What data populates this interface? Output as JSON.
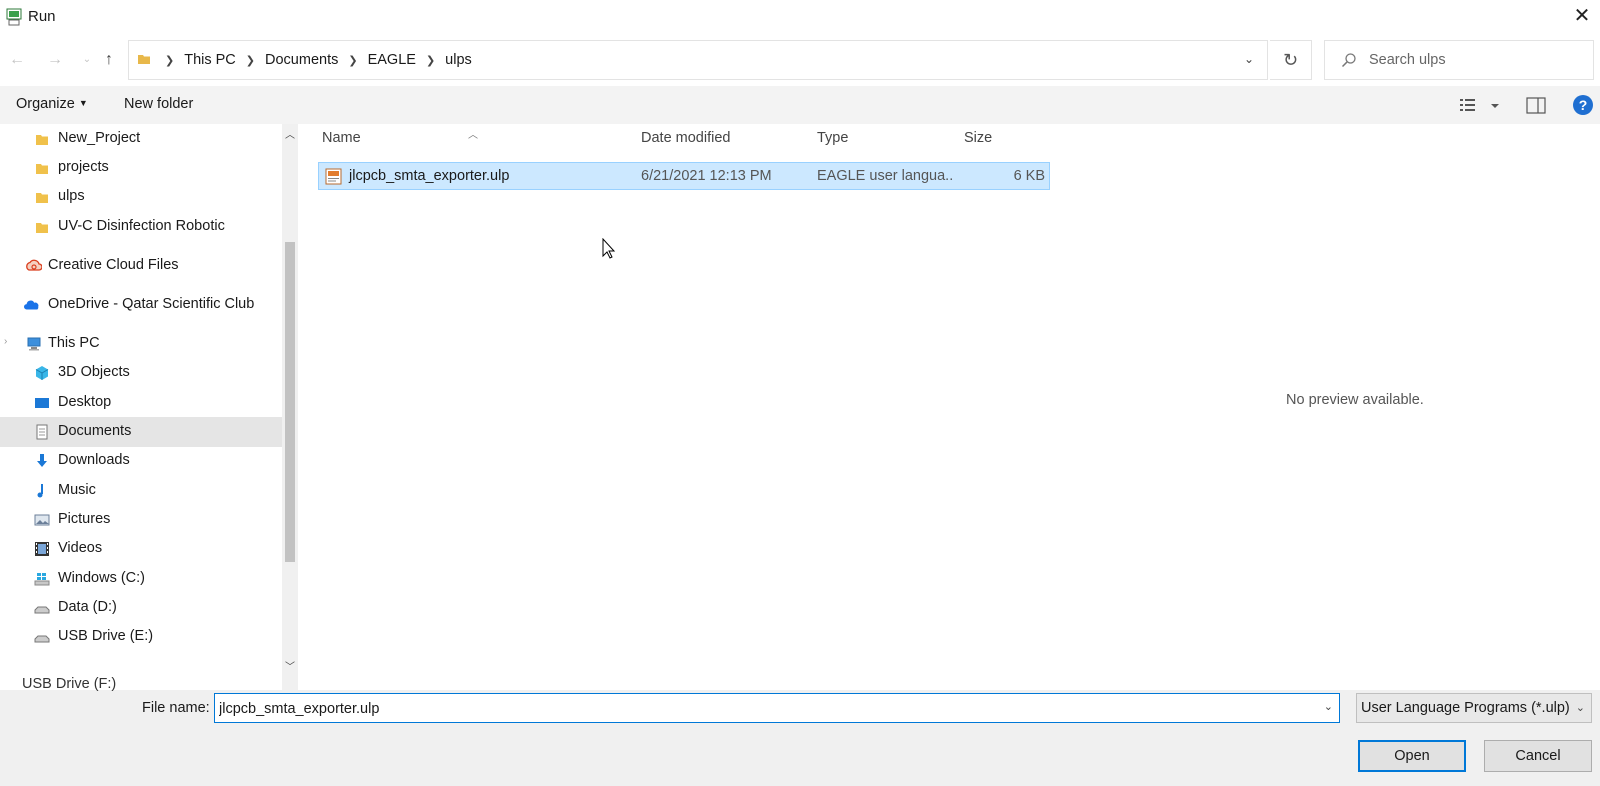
{
  "window": {
    "title": "Run"
  },
  "address": {
    "crumbs": [
      "This PC",
      "Documents",
      "EAGLE",
      "ulps"
    ]
  },
  "search": {
    "placeholder": "Search ulps"
  },
  "toolbar": {
    "organize": "Organize",
    "new_folder": "New folder"
  },
  "sidebar": {
    "items": [
      {
        "label": "New_Project",
        "icon": "folder-icon"
      },
      {
        "label": "projects",
        "icon": "folder-icon"
      },
      {
        "label": "ulps",
        "icon": "folder-icon"
      },
      {
        "label": "UV-C Disinfection Robotic",
        "icon": "folder-icon"
      },
      {
        "label": "Creative Cloud Files",
        "icon": "creative-cloud-icon"
      },
      {
        "label": "OneDrive - Qatar Scientific Club",
        "icon": "onedrive-icon"
      },
      {
        "label": "This PC",
        "icon": "computer-icon"
      },
      {
        "label": "3D Objects",
        "icon": "3d-objects-icon"
      },
      {
        "label": "Desktop",
        "icon": "desktop-icon"
      },
      {
        "label": "Documents",
        "icon": "documents-icon"
      },
      {
        "label": "Downloads",
        "icon": "downloads-icon"
      },
      {
        "label": "Music",
        "icon": "music-icon"
      },
      {
        "label": "Pictures",
        "icon": "pictures-icon"
      },
      {
        "label": "Videos",
        "icon": "videos-icon"
      },
      {
        "label": "Windows (C:)",
        "icon": "windows-drive-icon"
      },
      {
        "label": "Data (D:)",
        "icon": "drive-icon"
      },
      {
        "label": "USB Drive (E:)",
        "icon": "usb-drive-icon"
      }
    ],
    "partial_item": "USB Drive (F:)"
  },
  "columns": {
    "name": "Name",
    "date": "Date modified",
    "type": "Type",
    "size": "Size"
  },
  "files": [
    {
      "name": "jlcpcb_smta_exporter.ulp",
      "date": "6/21/2021 12:13 PM",
      "type": "EAGLE user langua...",
      "size": "6 KB"
    }
  ],
  "preview": {
    "text": "No preview available."
  },
  "bottom": {
    "file_name_label": "File name:",
    "file_name_value": "jlcpcb_smta_exporter.ulp",
    "filter": "User Language Programs (*.ulp)",
    "open": "Open",
    "cancel": "Cancel"
  },
  "colors": {
    "accent": "#0078d7",
    "selection": "#cce8ff",
    "help": "#1f6fd1"
  }
}
